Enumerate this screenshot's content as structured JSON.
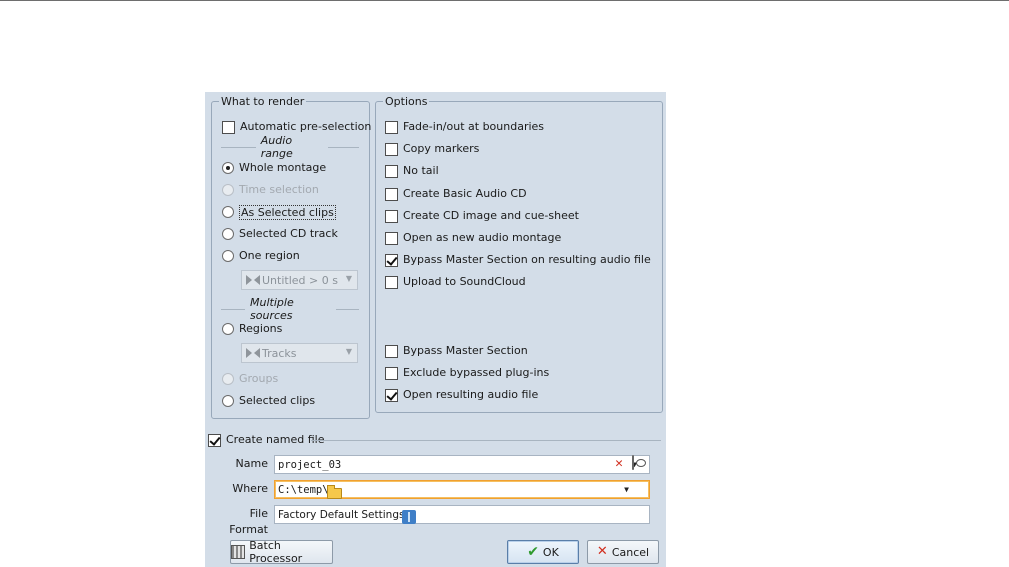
{
  "what_to_render": {
    "legend": "What to render",
    "automatic_preselection": {
      "label": "Automatic pre-selection",
      "checked": false
    },
    "audio_range_label": "Audio range",
    "whole_montage": "Whole montage",
    "time_selection": "Time selection",
    "as_selected_clips": "As Selected clips",
    "selected_cd_track": "Selected CD track",
    "one_region": "One region",
    "region_combo": "Untitled > 0 s",
    "multiple_sources_label": "Multiple sources",
    "regions": "Regions",
    "tracks_combo": "Tracks",
    "groups": "Groups",
    "selected_clips": "Selected clips",
    "selected_option": "Whole montage"
  },
  "options": {
    "legend": "Options",
    "items": [
      {
        "label": "Fade-in/out at boundaries",
        "checked": false
      },
      {
        "label": "Copy markers",
        "checked": false
      },
      {
        "label": "No tail",
        "checked": false
      },
      {
        "label": "Create Basic Audio CD",
        "checked": false
      },
      {
        "label": "Create CD image and cue-sheet",
        "checked": false
      },
      {
        "label": "Open as new audio montage",
        "checked": false
      },
      {
        "label": "Bypass Master Section on resulting audio file",
        "checked": true
      },
      {
        "label": "Upload to SoundCloud",
        "checked": false
      }
    ],
    "lower_items": [
      {
        "label": "Bypass Master Section",
        "checked": false
      },
      {
        "label": "Exclude bypassed plug-ins",
        "checked": false
      },
      {
        "label": "Open resulting audio file",
        "checked": true
      }
    ]
  },
  "named_file": {
    "label": "Create named file",
    "checked": true,
    "name_label": "Name",
    "name_value": "project_03",
    "where_label": "Where",
    "where_value": "C:\\temp\\",
    "format_label": "File Format",
    "format_value": "Factory Default Settings"
  },
  "buttons": {
    "batch": "Batch Processor",
    "ok": "OK",
    "cancel": "Cancel"
  },
  "colors": {
    "dialog_bg": "#d3dde8",
    "where_focus": "#f0a030"
  }
}
